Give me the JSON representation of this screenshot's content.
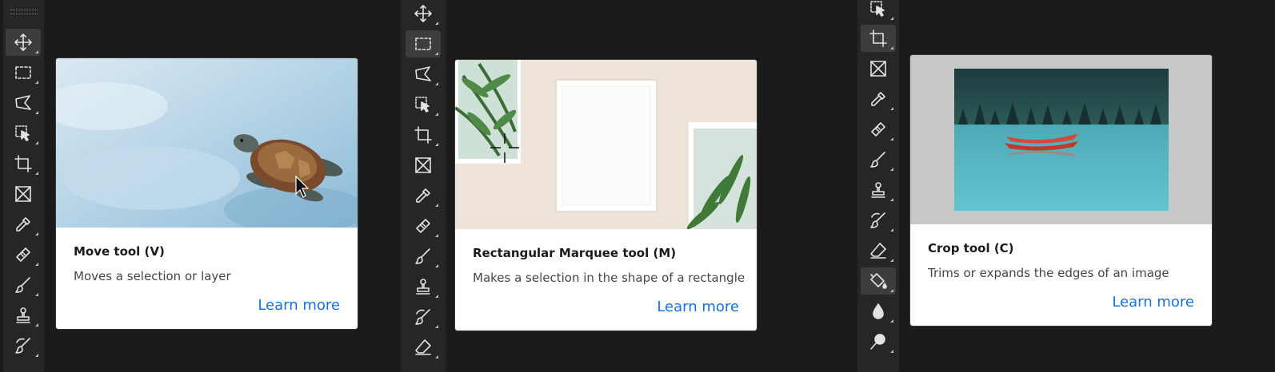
{
  "cards": [
    {
      "title": "Move tool (V)",
      "description": "Moves a selection or layer",
      "link": "Learn more"
    },
    {
      "title": "Rectangular Marquee tool (M)",
      "description": "Makes a selection in the shape of a rectangle",
      "link": "Learn more"
    },
    {
      "title": "Crop tool (C)",
      "description": "Trims or expands the edges of an image",
      "link": "Learn more"
    }
  ],
  "toolbars": [
    {
      "tools": [
        "move-icon",
        "rectangular-marquee-icon",
        "lasso-icon",
        "object-selection-icon",
        "crop-icon",
        "frame-icon",
        "eyedropper-icon",
        "healing-brush-icon",
        "brush-icon",
        "clone-stamp-icon",
        "history-brush-icon"
      ],
      "active": "move-icon"
    },
    {
      "tools": [
        "move-icon",
        "rectangular-marquee-icon",
        "lasso-icon",
        "object-selection-icon",
        "crop-icon",
        "frame-icon",
        "eyedropper-icon",
        "healing-brush-icon",
        "brush-icon",
        "clone-stamp-icon",
        "history-brush-icon",
        "eraser-icon"
      ],
      "active": "rectangular-marquee-icon"
    },
    {
      "tools": [
        "object-selection-icon",
        "crop-icon",
        "frame-icon",
        "eyedropper-icon",
        "healing-brush-icon",
        "brush-icon",
        "clone-stamp-icon",
        "history-brush-icon",
        "eraser-icon",
        "paint-bucket-icon",
        "blur-icon",
        "dodge-icon"
      ],
      "active": "paint-bucket-icon"
    }
  ],
  "colors": {
    "background": "#1b1b1b",
    "toolbar": "#262626",
    "link": "#1473e6",
    "active_tool": "#3d3d3d"
  }
}
